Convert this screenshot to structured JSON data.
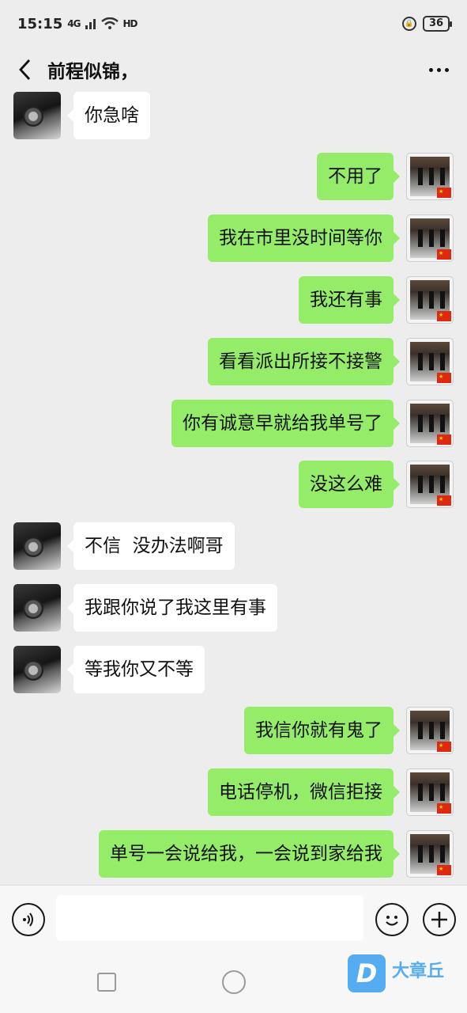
{
  "status_bar": {
    "time": "15:15",
    "signal": "4G",
    "network": "HD",
    "battery": "36"
  },
  "header": {
    "title": "前程似锦，"
  },
  "messages": [
    {
      "from": "them",
      "text": "你急啥"
    },
    {
      "from": "me",
      "text": "不用了"
    },
    {
      "from": "me",
      "text": "我在市里没时间等你"
    },
    {
      "from": "me",
      "text": "我还有事"
    },
    {
      "from": "me",
      "text": "看看派出所接不接警"
    },
    {
      "from": "me",
      "text": "你有诚意早就给我单号了"
    },
    {
      "from": "me",
      "text": "没这么难"
    },
    {
      "from": "them",
      "text": "不信  没办法啊哥"
    },
    {
      "from": "them",
      "text": "我跟你说了我这里有事"
    },
    {
      "from": "them",
      "text": "等我你又不等"
    },
    {
      "from": "me",
      "text": "我信你就有鬼了"
    },
    {
      "from": "me",
      "text": "电话停机，微信拒接"
    },
    {
      "from": "me",
      "text": "单号一会说给我，一会说到家给我"
    }
  ],
  "input": {
    "value": "",
    "placeholder": ""
  },
  "watermark": {
    "logo_letter": "D",
    "text": "大章丘"
  },
  "colors": {
    "background": "#ededed",
    "my_bubble": "#95ec69",
    "their_bubble": "#ffffff"
  }
}
